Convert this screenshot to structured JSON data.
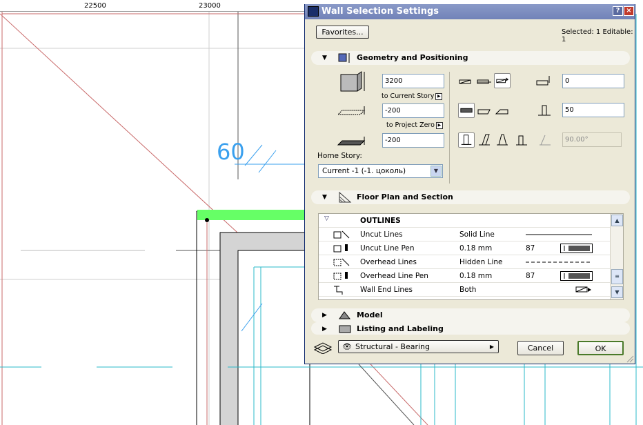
{
  "ruler": {
    "labels": [
      "22500",
      "23000"
    ]
  },
  "drawing": {
    "dimension_text": "60"
  },
  "dialog": {
    "title": "Wall Selection Settings",
    "help": "?",
    "close": "×",
    "favorites": "Favorites...",
    "selected_info": "Selected: 1 Editable: 1",
    "geometry": {
      "title": "Geometry and Positioning",
      "height_value": "3200",
      "to_current_story": "to Current Story",
      "bottom_offset": "-200",
      "to_project_zero": "to Project Zero",
      "project_zero_value": "-200",
      "home_story_label": "Home Story:",
      "home_story_value": "Current -1 (-1. цоколь)",
      "offset_value": "0",
      "thickness_value": "50",
      "angle_value": "90.00°"
    },
    "floor_plan": {
      "title": "Floor Plan and Section",
      "group": "OUTLINES",
      "rows": [
        {
          "name": "Uncut Lines",
          "value": "Solid Line",
          "code": ""
        },
        {
          "name": "Uncut Line Pen",
          "value": "0.18 mm",
          "code": "87"
        },
        {
          "name": "Overhead Lines",
          "value": "Hidden Line",
          "code": ""
        },
        {
          "name": "Overhead Line Pen",
          "value": "0.18 mm",
          "code": "87"
        },
        {
          "name": "Wall End Lines",
          "value": "Both",
          "code": ""
        }
      ]
    },
    "model": {
      "title": "Model"
    },
    "listing": {
      "title": "Listing and Labeling"
    },
    "layer_value": "Structural - Bearing",
    "cancel": "Cancel",
    "ok": "OK"
  },
  "colors": {
    "title_bar": "#7a8ac0",
    "dialog_bg": "#ece9d8",
    "highlight_wall": "#66ff66",
    "dimension": "#3aa0ee"
  }
}
